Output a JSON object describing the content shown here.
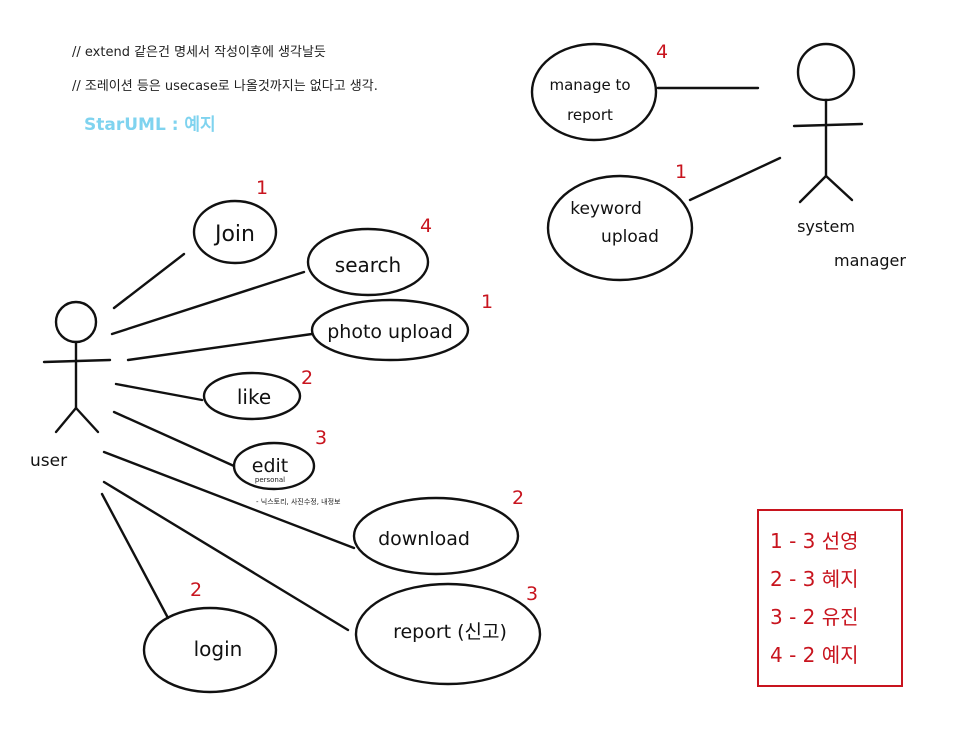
{
  "notes": {
    "line1": "// extend 같은건 명세서 작성이후에 생각날듯",
    "line2": "// 조레이션 등은 usecase로 나올것까지는 없다고 생각.",
    "tool": "StarUML : 예지"
  },
  "actors": {
    "user": "user",
    "system_manager_line1": "system",
    "system_manager_line2": "manager"
  },
  "usecases": [
    {
      "id": "join",
      "label": "Join",
      "num": "1"
    },
    {
      "id": "search",
      "label": "search",
      "num": "4"
    },
    {
      "id": "photo-upload",
      "label": "photo upload",
      "num": "1"
    },
    {
      "id": "like",
      "label": "like",
      "num": "2"
    },
    {
      "id": "edit",
      "label": "edit",
      "sub": "personal",
      "num": "3",
      "note": "- 닉스토리, 사진수정, 내정보"
    },
    {
      "id": "download",
      "label": "download",
      "num": "2"
    },
    {
      "id": "login",
      "label": "login",
      "num": "2"
    },
    {
      "id": "report",
      "label": "report (신고)",
      "num": "3"
    },
    {
      "id": "manage-report",
      "label1": "manage to",
      "label2": "report",
      "num": "4"
    },
    {
      "id": "keyword-upload",
      "label1": "keyword",
      "label2": "upload",
      "num": "1"
    }
  ],
  "legend": [
    "1 - 3 선영",
    "2 - 3 혜지",
    "3 - 2 유진",
    "4 - 2 예지"
  ],
  "colors": {
    "ink": "#111111",
    "numbers": "#c8141e",
    "tool_note": "#7fd3ef"
  }
}
